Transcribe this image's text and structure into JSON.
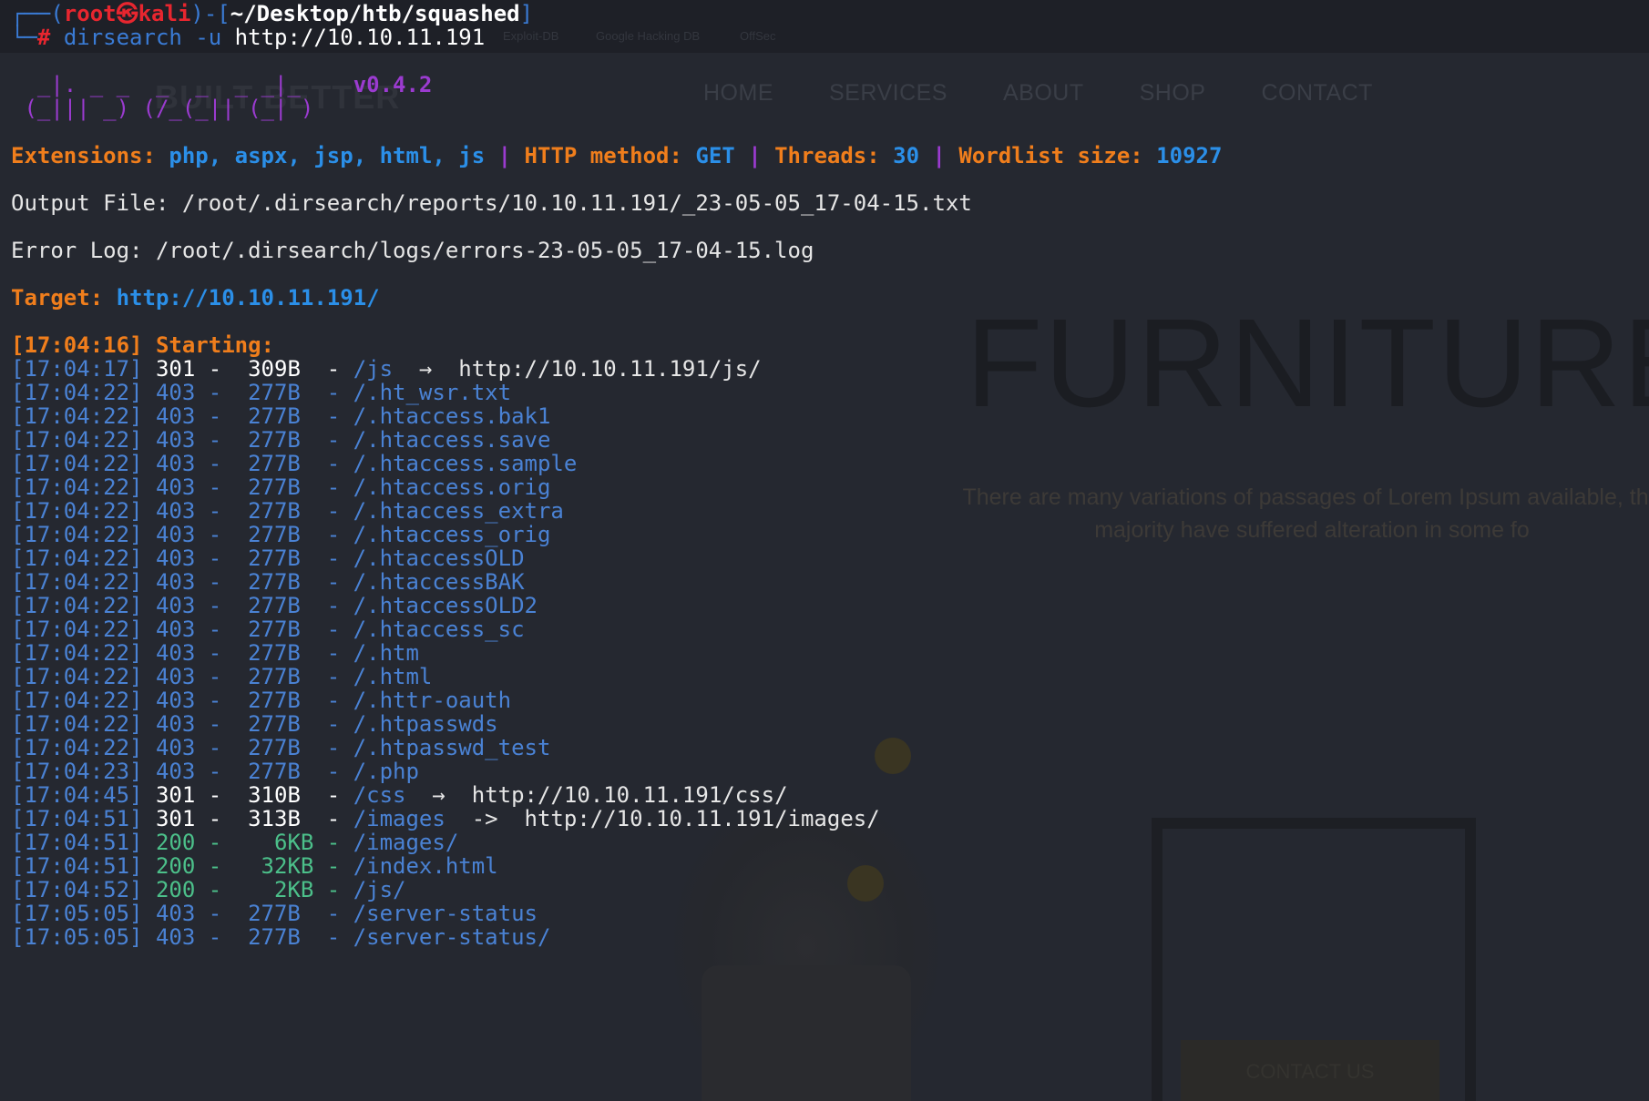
{
  "website": {
    "logo": "BUILT BETTER",
    "nav": [
      "HOME",
      "SERVICES",
      "ABOUT",
      "SHOP",
      "CONTACT"
    ],
    "bookmarks": [
      "Exploit-DB",
      "Google Hacking DB",
      "OffSec"
    ],
    "hero_title": "FURNITURE",
    "hero_paragraph": "There are many variations of passages of Lorem Ipsum available, the majority have suffered alteration in some fo",
    "cta_label": "CONTACT US"
  },
  "prompt": {
    "box_top": "┌──(",
    "user": "root㉿kali",
    "mid": ")-[",
    "cwd": "~/Desktop/htb/squashed",
    "end": "]",
    "box_bottom": "└─",
    "hash": "#",
    "command": "dirsearch",
    "flag": "-u",
    "url": "http://10.10.11.191"
  },
  "banner": {
    "art_line1": "  _|. _ _  _  _  _ _|_    ",
    "art_line2": " (_||| _) (/_(_|| (_| )",
    "version": "v0.4.2"
  },
  "info": {
    "extensions_label": "Extensions:",
    "extensions": "php, aspx, jsp, html, js",
    "method_label": "HTTP method:",
    "method": "GET",
    "threads_label": "Threads:",
    "threads": "30",
    "wordlist_label": "Wordlist size:",
    "wordlist": "10927",
    "separator": "|",
    "output_file": "Output File: /root/.dirsearch/reports/10.10.11.191/_23-05-05_17-04-15.txt",
    "error_log": "Error Log: /root/.dirsearch/logs/errors-23-05-05_17-04-15.log",
    "target_label": "Target:",
    "target": "http://10.10.11.191/",
    "start_time": "[17:04:16]",
    "start_label": "Starting:"
  },
  "results": [
    {
      "line": "[17:04:17] 301 -  309B  - /js  ",
      "redirect": "→  http://10.10.11.191/js/",
      "kind": "301"
    },
    {
      "line": "[17:04:22] 403 -  277B  - /.ht_wsr.txt",
      "redirect": "",
      "kind": "403"
    },
    {
      "line": "[17:04:22] 403 -  277B  - /.htaccess.bak1",
      "redirect": "",
      "kind": "403"
    },
    {
      "line": "[17:04:22] 403 -  277B  - /.htaccess.save",
      "redirect": "",
      "kind": "403"
    },
    {
      "line": "[17:04:22] 403 -  277B  - /.htaccess.sample",
      "redirect": "",
      "kind": "403"
    },
    {
      "line": "[17:04:22] 403 -  277B  - /.htaccess.orig",
      "redirect": "",
      "kind": "403"
    },
    {
      "line": "[17:04:22] 403 -  277B  - /.htaccess_extra",
      "redirect": "",
      "kind": "403"
    },
    {
      "line": "[17:04:22] 403 -  277B  - /.htaccess_orig",
      "redirect": "",
      "kind": "403"
    },
    {
      "line": "[17:04:22] 403 -  277B  - /.htaccessOLD",
      "redirect": "",
      "kind": "403"
    },
    {
      "line": "[17:04:22] 403 -  277B  - /.htaccessBAK",
      "redirect": "",
      "kind": "403"
    },
    {
      "line": "[17:04:22] 403 -  277B  - /.htaccessOLD2",
      "redirect": "",
      "kind": "403"
    },
    {
      "line": "[17:04:22] 403 -  277B  - /.htaccess_sc",
      "redirect": "",
      "kind": "403"
    },
    {
      "line": "[17:04:22] 403 -  277B  - /.htm",
      "redirect": "",
      "kind": "403"
    },
    {
      "line": "[17:04:22] 403 -  277B  - /.html",
      "redirect": "",
      "kind": "403"
    },
    {
      "line": "[17:04:22] 403 -  277B  - /.httr-oauth",
      "redirect": "",
      "kind": "403"
    },
    {
      "line": "[17:04:22] 403 -  277B  - /.htpasswds",
      "redirect": "",
      "kind": "403"
    },
    {
      "line": "[17:04:22] 403 -  277B  - /.htpasswd_test",
      "redirect": "",
      "kind": "403"
    },
    {
      "line": "[17:04:23] 403 -  277B  - /.php",
      "redirect": "",
      "kind": "403"
    },
    {
      "line": "[17:04:45] 301 -  310B  - /css  ",
      "redirect": "→  http://10.10.11.191/css/",
      "kind": "301"
    },
    {
      "line": "[17:04:51] 301 -  313B  - /images  ",
      "redirect": "->  http://10.10.11.191/images/",
      "kind": "301"
    },
    {
      "line": "[17:04:51] 200 -    6KB - /images/",
      "redirect": "",
      "kind": "200"
    },
    {
      "line": "[17:04:51] 200 -   32KB - /index.html",
      "redirect": "",
      "kind": "200"
    },
    {
      "line": "[17:04:52] 200 -    2KB - /js/",
      "redirect": "",
      "kind": "200"
    },
    {
      "line": "[17:05:05] 403 -  277B  - /server-status",
      "redirect": "",
      "kind": "403"
    },
    {
      "line": "[17:05:05] 403 -  277B  - /server-status/",
      "redirect": "",
      "kind": "403"
    }
  ]
}
